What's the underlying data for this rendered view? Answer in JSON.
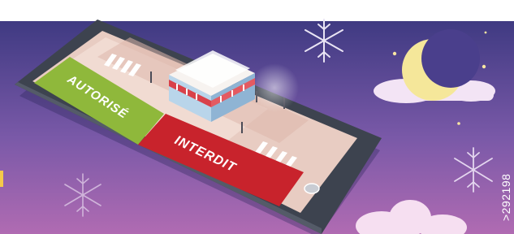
{
  "labels": {
    "allowed": "AUTORISÉ",
    "forbidden": "INTERDIT"
  },
  "reference_code": ">292198",
  "colors": {
    "sky_top": "#3f3a82",
    "sky_bottom": "#b06bb2",
    "phone_frame": "#3d434f",
    "allowed_green": "#8fb83b",
    "forbidden_red": "#c8232c",
    "moon": "#f5e79a"
  },
  "icons": [
    "snowflake-icon",
    "moon-icon",
    "star-icon",
    "cloud-icon",
    "shop-icon",
    "home-button-icon"
  ]
}
